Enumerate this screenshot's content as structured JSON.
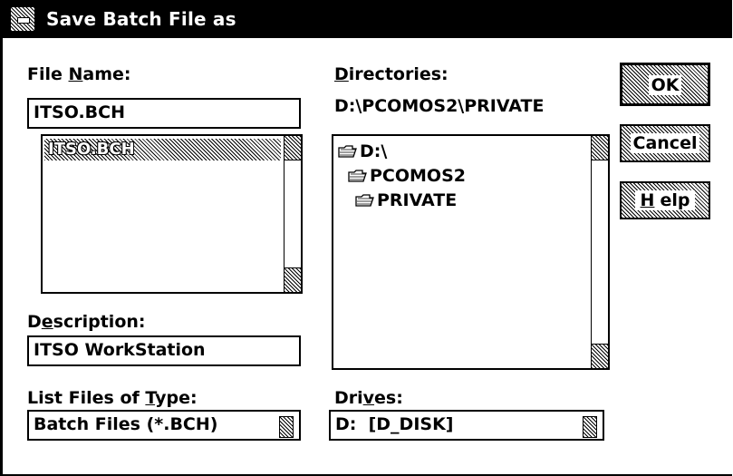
{
  "window": {
    "title": "Save Batch File as",
    "system_menu_icon": "system-menu-icon"
  },
  "file_name": {
    "label_pre": "File ",
    "label_accel": "N",
    "label_post": "ame:",
    "value": "ITSO.BCH",
    "list_items": [
      "ITSO.BCH"
    ],
    "selected_item": "ITSO.BCH"
  },
  "directories": {
    "label_accel": "D",
    "label_post": "irectories:",
    "current_path": "D:\\PCOMOS2\\PRIVATE",
    "tree": [
      {
        "label": "D:\\",
        "icon": "open-folder-icon"
      },
      {
        "label": "PCOMOS2",
        "icon": "open-folder-icon"
      },
      {
        "label": "PRIVATE",
        "icon": "open-folder-icon"
      }
    ]
  },
  "description": {
    "label_pre": "D",
    "label_accel": "e",
    "label_post": "scription:",
    "value": "ITSO WorkStation"
  },
  "file_type": {
    "label_pre": "List Files of ",
    "label_accel": "T",
    "label_post": "ype:",
    "value": "Batch Files (*.BCH)"
  },
  "drives": {
    "label_pre": "Dri",
    "label_accel": "v",
    "label_post": "es:",
    "value": "D:  [D_DISK]"
  },
  "buttons": {
    "ok": "OK",
    "cancel": "Cancel",
    "help_accel": "H",
    "help_post": "elp"
  }
}
